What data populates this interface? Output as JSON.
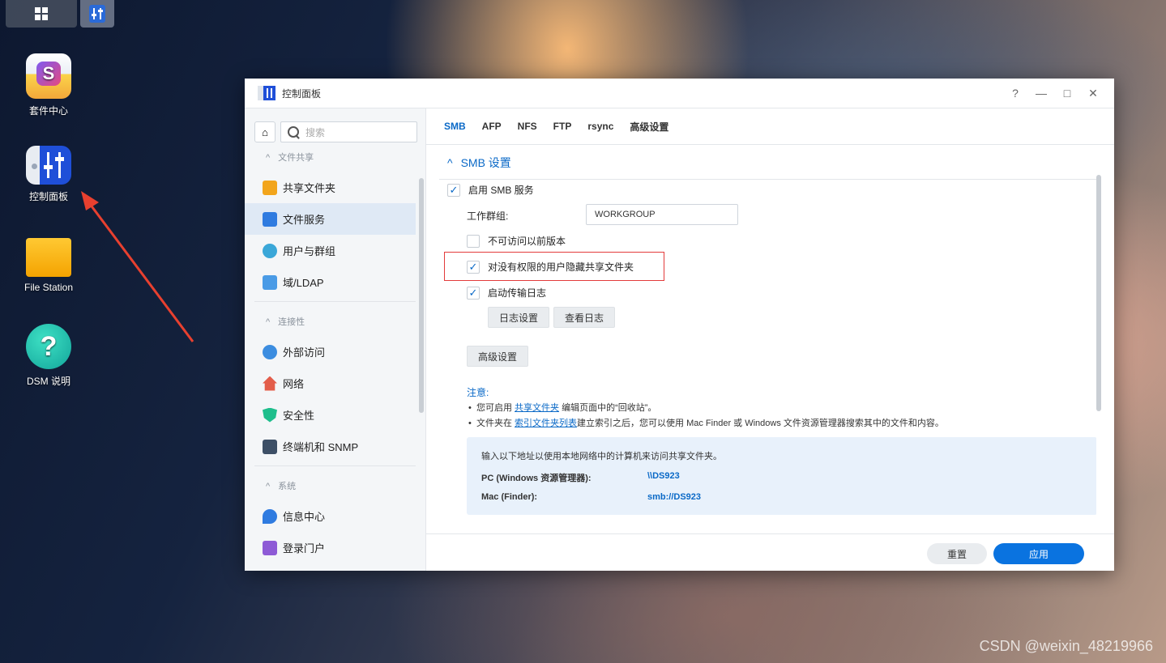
{
  "desktop": {
    "icons": [
      {
        "label": "套件中心",
        "icon": "package-center-icon"
      },
      {
        "label": "控制面板",
        "icon": "control-panel-icon"
      },
      {
        "label": "File Station",
        "icon": "folder-icon"
      },
      {
        "label": "DSM 说明",
        "icon": "help-icon"
      }
    ],
    "watermark": "CSDN @weixin_48219966"
  },
  "window": {
    "title": "控制面板",
    "controls": {
      "help": "?",
      "minimize": "—",
      "maximize": "□",
      "close": "✕"
    }
  },
  "sidebar": {
    "search_placeholder": "搜索",
    "sections": [
      {
        "title": "文件共享",
        "items": [
          "共享文件夹",
          "文件服务",
          "用户与群组",
          "域/LDAP"
        ]
      },
      {
        "title": "连接性",
        "items": [
          "外部访问",
          "网络",
          "安全性",
          "终端机和 SNMP"
        ]
      },
      {
        "title": "系统",
        "items": [
          "信息中心",
          "登录门户"
        ]
      }
    ],
    "active_item": "文件服务"
  },
  "tabs": [
    "SMB",
    "AFP",
    "NFS",
    "FTP",
    "rsync",
    "高级设置"
  ],
  "active_tab": "SMB",
  "smb": {
    "section_title": "SMB 设置",
    "enable_label": "启用 SMB 服务",
    "enable_checked": true,
    "workgroup_label": "工作群组:",
    "workgroup_value": "WORKGROUP",
    "prev_versions_label": "不可访问以前版本",
    "prev_versions_checked": false,
    "hide_shares_label": "对没有权限的用户隐藏共享文件夹",
    "hide_shares_checked": true,
    "transfer_log_label": "启动传输日志",
    "transfer_log_checked": true,
    "log_settings_button": "日志设置",
    "view_log_button": "查看日志",
    "advanced_button": "高级设置"
  },
  "notes": {
    "title": "注意:",
    "line1_pre": "您可启用 ",
    "line1_link": "共享文件夹",
    "line1_post": " 编辑页面中的“回收站”。",
    "line2_pre": "文件夹在 ",
    "line2_link": "索引文件夹列表",
    "line2_post": "建立索引之后，您可以使用 Mac Finder 或 Windows 文件资源管理器搜索其中的文件和内容。"
  },
  "info": {
    "intro": "输入以下地址以使用本地网络中的计算机来访问共享文件夹。",
    "pc_label": "PC (Windows 资源管理器):",
    "pc_value": "\\\\DS923",
    "mac_label": "Mac (Finder):",
    "mac_value": "smb://DS923"
  },
  "footer": {
    "reset": "重置",
    "apply": "应用"
  },
  "colors": {
    "accent": "#0a69c7",
    "highlight_box": "#e33b3b",
    "arrow": "#e8402f"
  }
}
